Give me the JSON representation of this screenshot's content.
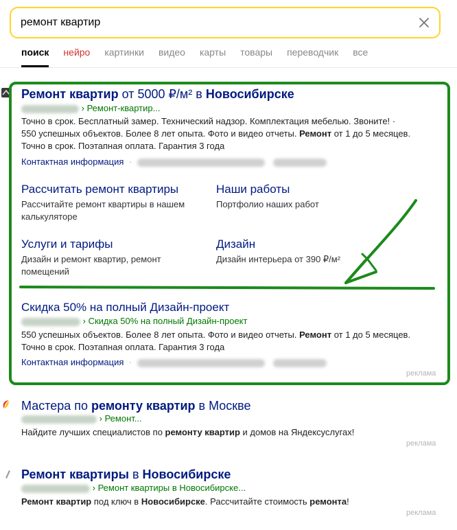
{
  "search": {
    "query": "ремонт квартир"
  },
  "tabs": [
    {
      "label": "поиск"
    },
    {
      "label": "нейро"
    },
    {
      "label": "картинки"
    },
    {
      "label": "видео"
    },
    {
      "label": "карты"
    },
    {
      "label": "товары"
    },
    {
      "label": "переводчик"
    },
    {
      "label": "все"
    }
  ],
  "ad1": {
    "title_a": "Ремонт квартир",
    "title_b": " от 5000 ₽/м² в ",
    "title_c": "Новосибирске",
    "path": "› Ремонт-квартир...",
    "desc_line1": "Точно в срок. Бесплатный замер. Технический надзор. Комплектация мебелью. Звоните! ·",
    "desc_line2_a": "550 успешных объектов. Более 8 лет опыта. Фото и видео отчеты. ",
    "desc_line2_b": "Ремонт",
    "desc_line2_c": " от 1 до 5 месяцев.",
    "desc_line3": "Точно в срок. Поэтапная оплата. Гарантия 3 года",
    "contact": "Контактная информация",
    "sitelinks": [
      {
        "title": "Рассчитать ремонт квартиры",
        "desc": "Рассчитайте ремонт квартиры в нашем калькуляторе"
      },
      {
        "title": "Наши работы",
        "desc": "Портфолио наших работ"
      },
      {
        "title": "Услуги и тарифы",
        "desc": "Дизайн и ремонт квартир, ремонт помещений"
      },
      {
        "title": "Дизайн",
        "desc": "Дизайн интерьера от 390 ₽/м²"
      }
    ],
    "sub_title": "Скидка 50% на полный Дизайн-проект",
    "sub_path": "› Скидка 50% на полный Дизайн-проект",
    "sub_desc_line1_a": "550 успешных объектов. Более 8 лет опыта. Фото и видео отчеты. ",
    "sub_desc_line1_b": "Ремонт",
    "sub_desc_line1_c": " от 1 до 5 месяцев.",
    "sub_desc_line2": "Точно в срок. Поэтапная оплата. Гарантия 3 года",
    "sub_contact": "Контактная информация",
    "ad_label": "реклама"
  },
  "ad2": {
    "title_a": "Мастера по ",
    "title_b": "ремонту квартир",
    "title_c": " в Москве",
    "path": "› Ремонт...",
    "desc_a": "Найдите лучших специалистов по ",
    "desc_b": "ремонту квартир",
    "desc_c": " и домов на Яндексуслугах!",
    "ad_label": "реклама"
  },
  "ad3": {
    "title_a": "Ремонт квартиры",
    "title_b": " в ",
    "title_c": "Новосибирске",
    "path": "› Ремонт квартиры в Новосибирске...",
    "desc_a": "Ремонт квартир",
    "desc_b": " под ключ в ",
    "desc_c": "Новосибирске",
    "desc_d": ". Рассчитайте стоимость ",
    "desc_e": "ремонта",
    "desc_f": "!",
    "ad_label": "реклама"
  },
  "colors": {
    "search_border": "#fed42b",
    "link": "#001a80",
    "url_green": "#007700",
    "annotation_green": "#1c8a1c",
    "tab_neuro": "#d0342c"
  }
}
